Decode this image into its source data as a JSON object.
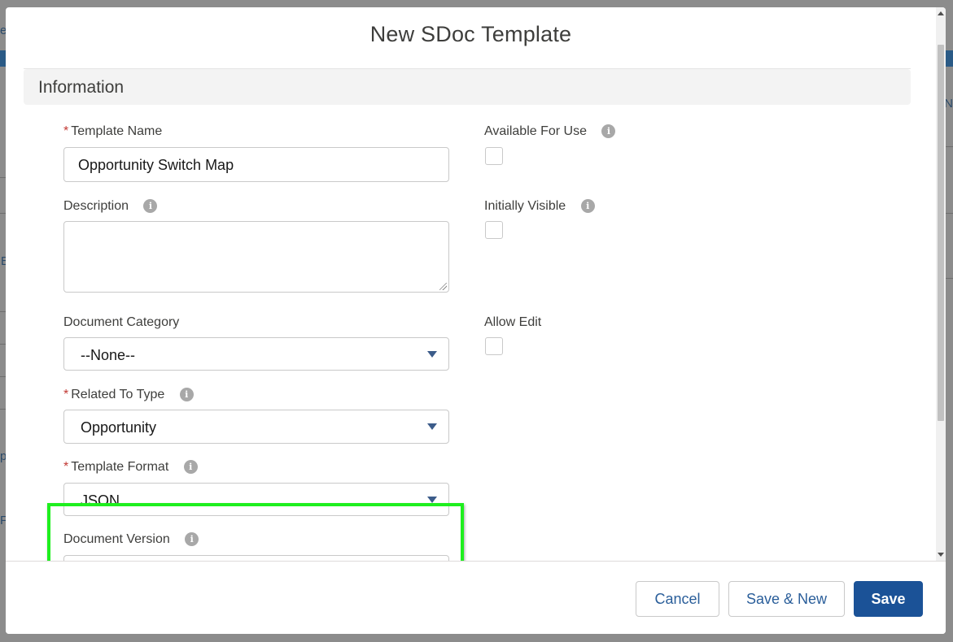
{
  "background": {
    "left_letters": [
      "e",
      "E",
      "p",
      "F"
    ],
    "right_letters": [
      "N"
    ]
  },
  "modal": {
    "title": "New SDoc Template"
  },
  "section": {
    "title": "Information"
  },
  "fields": {
    "template_name": {
      "label": "Template Name",
      "value": "Opportunity Switch Map",
      "required_mark": "*"
    },
    "description": {
      "label": "Description",
      "value": ""
    },
    "document_category": {
      "label": "Document Category",
      "selected": "--None--"
    },
    "related_to_type": {
      "label": "Related To Type",
      "selected": "Opportunity",
      "required_mark": "*"
    },
    "template_format": {
      "label": "Template Format",
      "selected": "JSON",
      "required_mark": "*"
    },
    "document_version": {
      "label": "Document Version",
      "value": ""
    },
    "available_for_use": {
      "label": "Available For Use",
      "checked": false
    },
    "initially_visible": {
      "label": "Initially Visible",
      "checked": false
    },
    "allow_edit": {
      "label": "Allow Edit",
      "checked": false
    }
  },
  "icons": {
    "info": "i"
  },
  "footer": {
    "cancel_label": "Cancel",
    "save_new_label": "Save & New",
    "save_label": "Save"
  },
  "colors": {
    "primary": "#1b5297",
    "required": "#c23934",
    "highlight": "#1eef1e"
  }
}
